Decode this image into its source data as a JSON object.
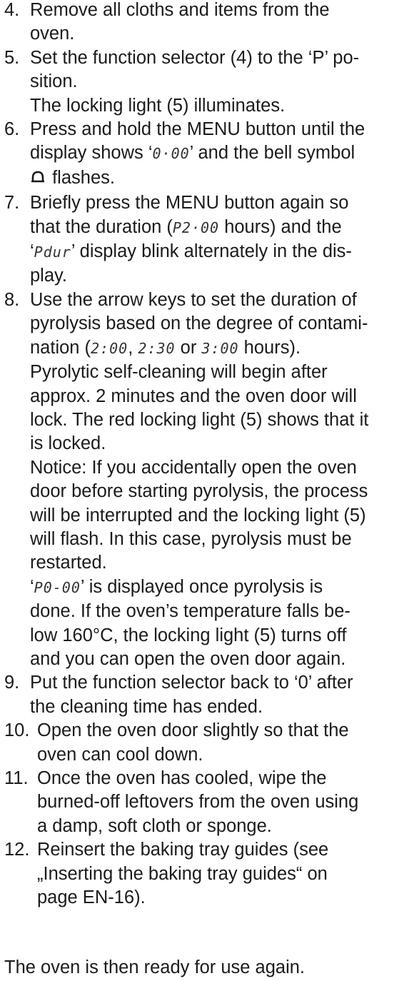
{
  "steps": [
    {
      "num": "4.",
      "lines": [
        [
          {
            "t": "Remove all cloths and items from the"
          }
        ],
        [
          {
            "t": "oven."
          }
        ]
      ]
    },
    {
      "num": "5.",
      "lines": [
        [
          {
            "t": "Set the function selector (4) to the ‘P’ po-"
          }
        ],
        [
          {
            "t": "sition."
          }
        ],
        [
          {
            "t": "The locking light (5) illuminates."
          }
        ]
      ]
    },
    {
      "num": "6.",
      "lines": [
        [
          {
            "t": "Press and hold the MENU button until the"
          }
        ],
        [
          {
            "t": "display shows ‘"
          },
          {
            "seg": "0·00"
          },
          {
            "t": "’ and the bell symbol"
          }
        ],
        [
          {
            "icon": "bell"
          },
          {
            "t": " flashes."
          }
        ]
      ]
    },
    {
      "num": "7.",
      "lines": [
        [
          {
            "t": "Briefly press the MENU button again so"
          }
        ],
        [
          {
            "t": "that the duration ("
          },
          {
            "seg": "P2·00"
          },
          {
            "t": " hours) and the"
          }
        ],
        [
          {
            "t": "‘"
          },
          {
            "seg": "Pdur"
          },
          {
            "t": "’ display blink alternately in the dis-"
          }
        ],
        [
          {
            "t": "play."
          }
        ]
      ]
    },
    {
      "num": "8.",
      "lines": [
        [
          {
            "t": "Use the arrow keys to set the duration of"
          }
        ],
        [
          {
            "t": "pyrolysis based on the degree of contami-"
          }
        ],
        [
          {
            "t": "nation ("
          },
          {
            "seg": "2:00"
          },
          {
            "t": ", "
          },
          {
            "seg": "2:30"
          },
          {
            "t": " or "
          },
          {
            "seg": "3:00"
          },
          {
            "t": " hours)."
          }
        ],
        [
          {
            "t": "Pyrolytic self-cleaning will begin after"
          }
        ],
        [
          {
            "t": "approx. 2 minutes and the oven door will"
          }
        ],
        [
          {
            "t": "lock. The red locking light (5) shows that it"
          }
        ],
        [
          {
            "t": "is locked."
          }
        ],
        [
          {
            "t": "Notice: If you accidentally open the oven"
          }
        ],
        [
          {
            "t": "door before starting pyrolysis, the process"
          }
        ],
        [
          {
            "t": "will be interrupted and the locking light (5)"
          }
        ],
        [
          {
            "t": "will flash. In this case, pyrolysis must be"
          }
        ],
        [
          {
            "t": "restarted."
          }
        ],
        [
          {
            "t": "‘"
          },
          {
            "seg": "P0-00"
          },
          {
            "t": "’ is displayed once pyrolysis is"
          }
        ],
        [
          {
            "t": "done. If the oven’s temperature falls be-"
          }
        ],
        [
          {
            "t": "low 160°C, the locking light (5) turns off"
          }
        ],
        [
          {
            "t": "and you can open the oven door again."
          }
        ]
      ]
    },
    {
      "num": "9.",
      "lines": [
        [
          {
            "t": "Put the function selector back to ‘0’ after"
          }
        ],
        [
          {
            "t": "the cleaning time has ended."
          }
        ]
      ]
    },
    {
      "num": "10.",
      "lines": [
        [
          {
            "t": "Open the oven door slightly so that the"
          }
        ],
        [
          {
            "t": "oven can cool down."
          }
        ]
      ]
    },
    {
      "num": "11.",
      "lines": [
        [
          {
            "t": "Once the oven has cooled, wipe the"
          }
        ],
        [
          {
            "t": "burned-off leftovers from the oven using"
          }
        ],
        [
          {
            "t": "a damp, soft cloth or sponge."
          }
        ]
      ]
    },
    {
      "num": "12.",
      "lines": [
        [
          {
            "t": "Reinsert the baking tray guides (see"
          }
        ],
        [
          {
            "t": "„Inserting the baking tray guides“ on"
          }
        ],
        [
          {
            "t": "page EN-16)."
          }
        ]
      ]
    }
  ],
  "footer": "The oven is then ready for use again."
}
